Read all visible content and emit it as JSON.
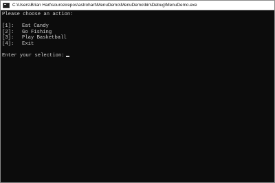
{
  "window": {
    "title": "C:\\Users\\Brian Hart\\source\\repos\\astrohart\\MenuDemo\\MenuDemo\\bin\\Debug\\MenuDemo.exe"
  },
  "console": {
    "prompt_header": "Please choose an action:",
    "menu_items": [
      {
        "key": "[1]:",
        "label": "Eat Candy"
      },
      {
        "key": "[2]:",
        "label": "Go Fishing"
      },
      {
        "key": "[3]:",
        "label": "Play Basketball"
      },
      {
        "key": "[4]:",
        "label": "Exit"
      }
    ],
    "selection_prompt": "Enter your selection:",
    "input_value": ""
  },
  "colors": {
    "console_background": "#0c0c0c",
    "console_text": "#d3d3d3",
    "titlebar_background": "#ffffff"
  },
  "icons": {
    "app": "console-app-icon"
  }
}
